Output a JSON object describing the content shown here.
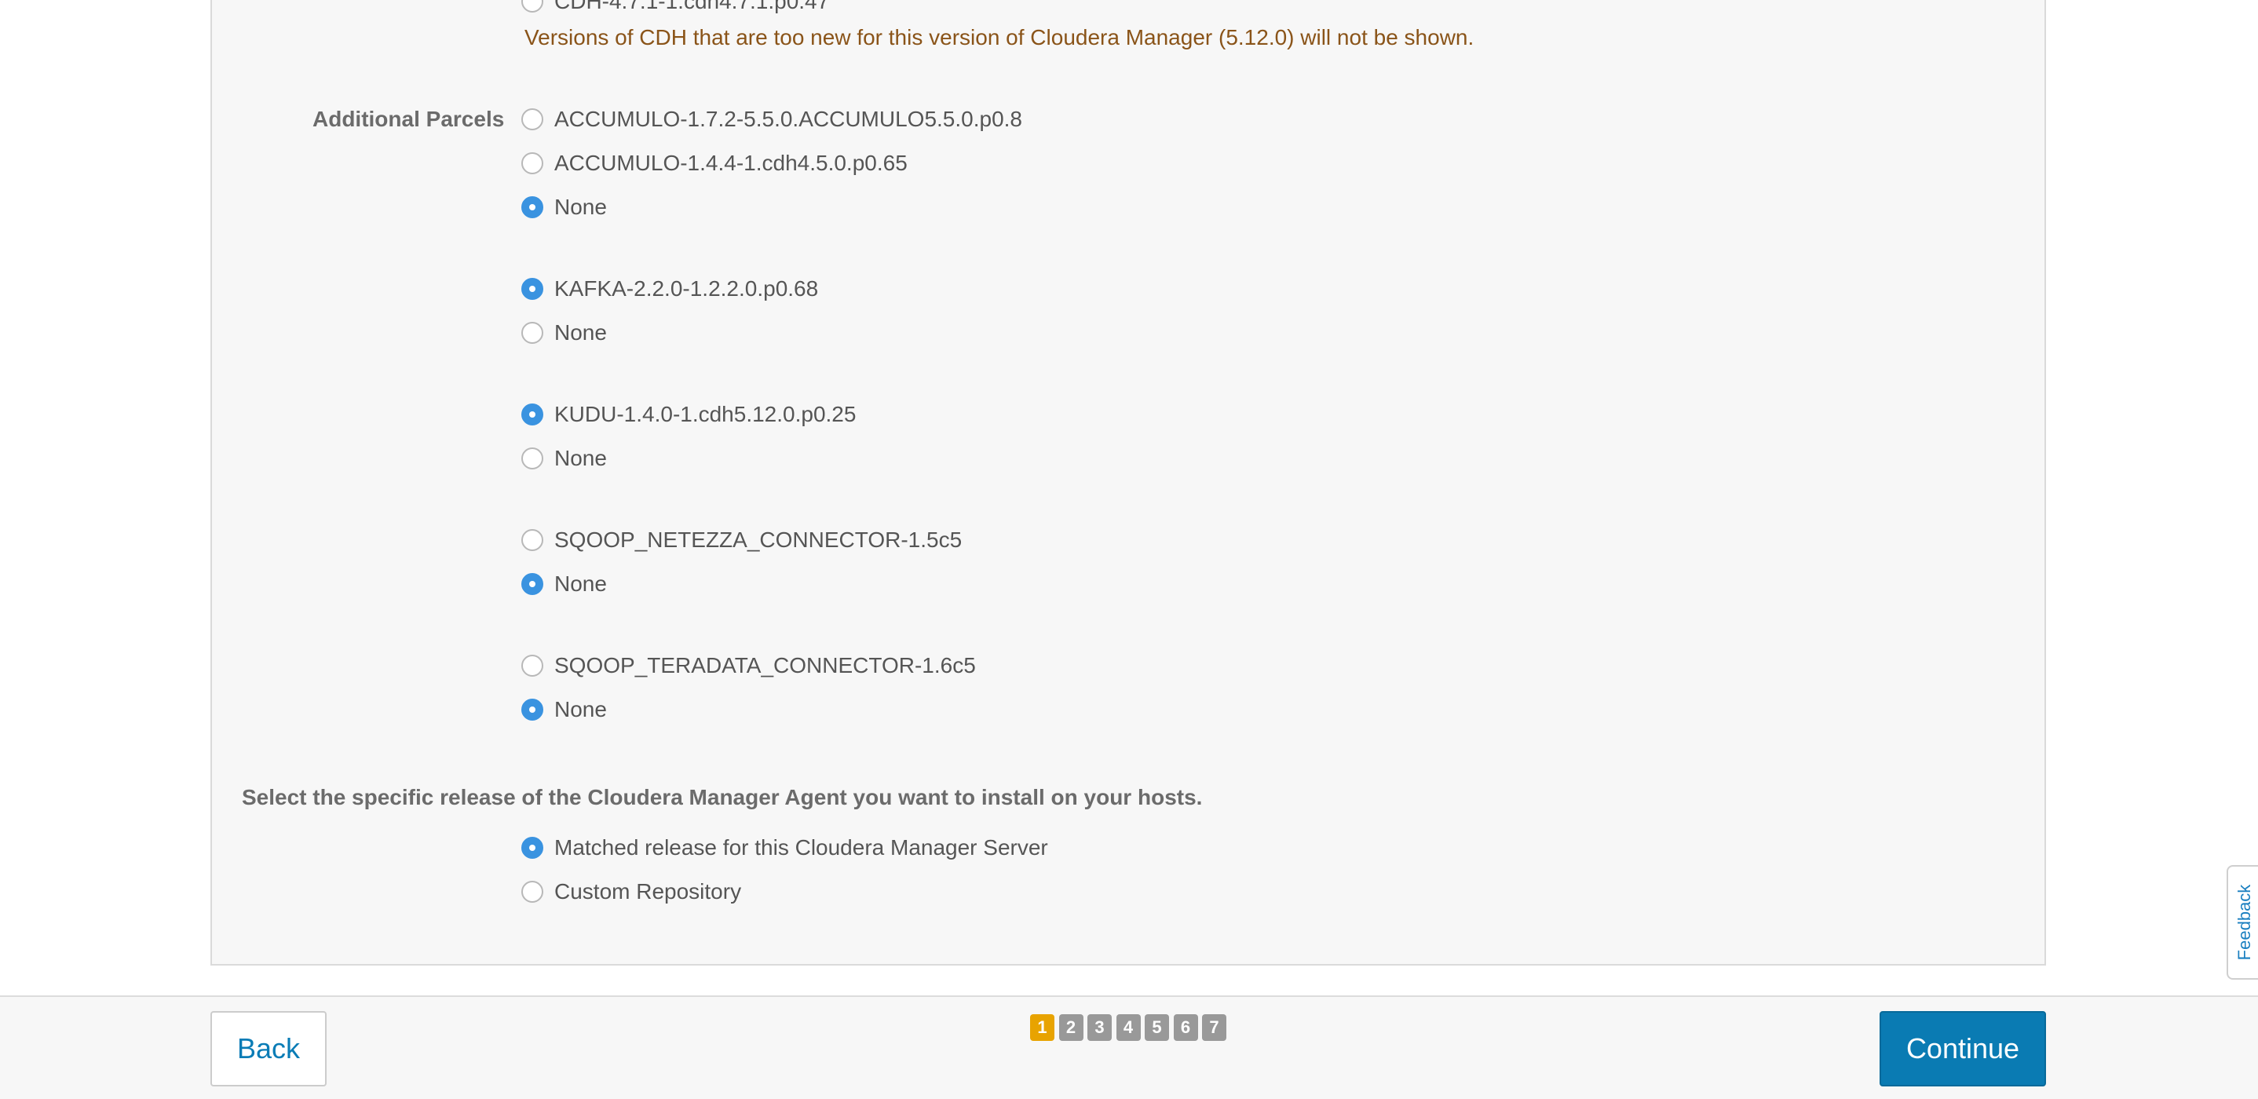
{
  "cdh_versions": {
    "items": [
      {
        "label": "CDH-4.7.1-1.cdh4.7.1.p0.47",
        "checked": false
      }
    ],
    "notice": "Versions of CDH that are too new for this version of Cloudera Manager (5.12.0) will not be shown."
  },
  "additional_parcels": {
    "label": "Additional Parcels",
    "groups": [
      {
        "options": [
          {
            "label": "ACCUMULO-1.7.2-5.5.0.ACCUMULO5.5.0.p0.8",
            "checked": false
          },
          {
            "label": "ACCUMULO-1.4.4-1.cdh4.5.0.p0.65",
            "checked": false
          },
          {
            "label": "None",
            "checked": true
          }
        ]
      },
      {
        "options": [
          {
            "label": "KAFKA-2.2.0-1.2.2.0.p0.68",
            "checked": true
          },
          {
            "label": "None",
            "checked": false
          }
        ]
      },
      {
        "options": [
          {
            "label": "KUDU-1.4.0-1.cdh5.12.0.p0.25",
            "checked": true
          },
          {
            "label": "None",
            "checked": false
          }
        ]
      },
      {
        "options": [
          {
            "label": "SQOOP_NETEZZA_CONNECTOR-1.5c5",
            "checked": false
          },
          {
            "label": "None",
            "checked": true
          }
        ]
      },
      {
        "options": [
          {
            "label": "SQOOP_TERADATA_CONNECTOR-1.6c5",
            "checked": false
          },
          {
            "label": "None",
            "checked": true
          }
        ]
      }
    ]
  },
  "agent_release": {
    "heading": "Select the specific release of the Cloudera Manager Agent you want to install on your hosts.",
    "options": [
      {
        "label": "Matched release for this Cloudera Manager Server",
        "checked": true
      },
      {
        "label": "Custom Repository",
        "checked": false
      }
    ]
  },
  "footer": {
    "back_label": "Back",
    "continue_label": "Continue",
    "steps": [
      "1",
      "2",
      "3",
      "4",
      "5",
      "6",
      "7"
    ],
    "current_step": 1
  },
  "feedback_label": "Feedback",
  "colors": {
    "accent": "#0a7bb3",
    "radio_checked": "#3a93e0",
    "step_active": "#e8a300",
    "step_inactive": "#999999",
    "notice_text": "#8a5419"
  }
}
